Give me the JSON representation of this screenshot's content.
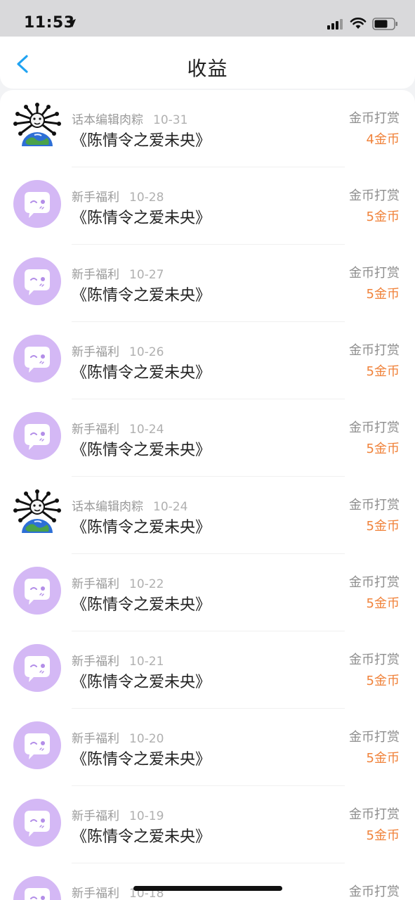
{
  "status_bar": {
    "time": "11:53"
  },
  "nav": {
    "title": "收益"
  },
  "colors": {
    "accent": "#1fa3f2",
    "amount": "#f0823a",
    "avatar_purple": "#d4b8f5"
  },
  "records": [
    {
      "avatar": "editor-avatar",
      "sender": "话本编辑肉粽",
      "date": "10-31",
      "title": "《陈情令之爱未央》",
      "type": "金币打赏",
      "amount": "4金币"
    },
    {
      "avatar": "chat-bubble-icon",
      "sender": "新手福利",
      "date": "10-28",
      "title": "《陈情令之爱未央》",
      "type": "金币打赏",
      "amount": "5金币"
    },
    {
      "avatar": "chat-bubble-icon",
      "sender": "新手福利",
      "date": "10-27",
      "title": "《陈情令之爱未央》",
      "type": "金币打赏",
      "amount": "5金币"
    },
    {
      "avatar": "chat-bubble-icon",
      "sender": "新手福利",
      "date": "10-26",
      "title": "《陈情令之爱未央》",
      "type": "金币打赏",
      "amount": "5金币"
    },
    {
      "avatar": "chat-bubble-icon",
      "sender": "新手福利",
      "date": "10-24",
      "title": "《陈情令之爱未央》",
      "type": "金币打赏",
      "amount": "5金币"
    },
    {
      "avatar": "editor-avatar",
      "sender": "话本编辑肉粽",
      "date": "10-24",
      "title": "《陈情令之爱未央》",
      "type": "金币打赏",
      "amount": "5金币"
    },
    {
      "avatar": "chat-bubble-icon",
      "sender": "新手福利",
      "date": "10-22",
      "title": "《陈情令之爱未央》",
      "type": "金币打赏",
      "amount": "5金币"
    },
    {
      "avatar": "chat-bubble-icon",
      "sender": "新手福利",
      "date": "10-21",
      "title": "《陈情令之爱未央》",
      "type": "金币打赏",
      "amount": "5金币"
    },
    {
      "avatar": "chat-bubble-icon",
      "sender": "新手福利",
      "date": "10-20",
      "title": "《陈情令之爱未央》",
      "type": "金币打赏",
      "amount": "5金币"
    },
    {
      "avatar": "chat-bubble-icon",
      "sender": "新手福利",
      "date": "10-19",
      "title": "《陈情令之爱未央》",
      "type": "金币打赏",
      "amount": "5金币"
    },
    {
      "avatar": "chat-bubble-icon",
      "sender": "新手福利",
      "date": "10-18",
      "title": "",
      "type": "金币打赏",
      "amount": ""
    }
  ]
}
